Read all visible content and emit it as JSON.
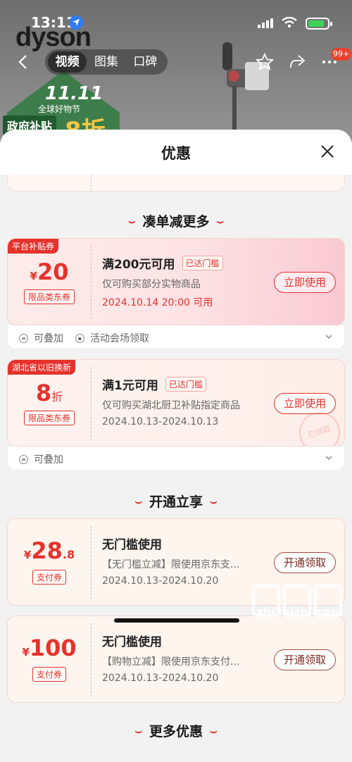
{
  "status_bar": {
    "time": "13:11"
  },
  "header": {
    "brand": "dyson",
    "tabs": [
      "视频",
      "图集",
      "口碑"
    ],
    "cart_badge": "99+",
    "promo": {
      "event": "11.11",
      "sub": "全球好物节",
      "tag": "政府补贴",
      "big": "8折"
    }
  },
  "sheet": {
    "title": "优惠",
    "sections": [
      {
        "title": "凑单减更多"
      },
      {
        "title": "开通立享"
      },
      {
        "title": "更多优惠"
      }
    ],
    "coupons": [
      {
        "tag": "平台补贴券",
        "currency": "¥",
        "amount": "20",
        "decimal": "",
        "unit": "",
        "type": "限品类东券",
        "title": "满200元可用",
        "reach": "已达门槛",
        "desc": "仅可购买部分实物商品",
        "date": "2024.10.14 20:00 可用",
        "button": "立即使用",
        "foot": [
          "可叠加",
          "活动会场领取"
        ]
      },
      {
        "tag": "湖北省以旧换新",
        "currency": "",
        "amount": "8",
        "decimal": "",
        "unit": "折",
        "type": "限品类东券",
        "title": "满1元可用",
        "reach": "已达门槛",
        "desc": "仅可购买湖北厨卫补贴指定商品",
        "date": "2024.10.13-2024.10.13",
        "button": "立即使用",
        "stamp": "已领取",
        "foot": [
          "可叠加"
        ]
      },
      {
        "currency": "¥",
        "amount": "28",
        "decimal": ".8",
        "unit": "",
        "type": "支付券",
        "title": "无门槛使用",
        "desc": "【无门槛立减】限使用京东支...",
        "date": "2024.10.13-2024.10.20",
        "button": "开通领取"
      },
      {
        "currency": "¥",
        "amount": "100",
        "decimal": "",
        "unit": "",
        "type": "支付券",
        "title": "无门槛使用",
        "desc": "【购物立减】限使用京东支付...",
        "date": "2024.10.13-2024.10.20",
        "button": "开通领取"
      }
    ]
  },
  "watermark": {
    "text": "zhizhizhi.com"
  },
  "colors": {
    "accent": "#e5322d",
    "sheet_bg": "#f2f2f2",
    "brand_green": "#1f5b2e"
  }
}
